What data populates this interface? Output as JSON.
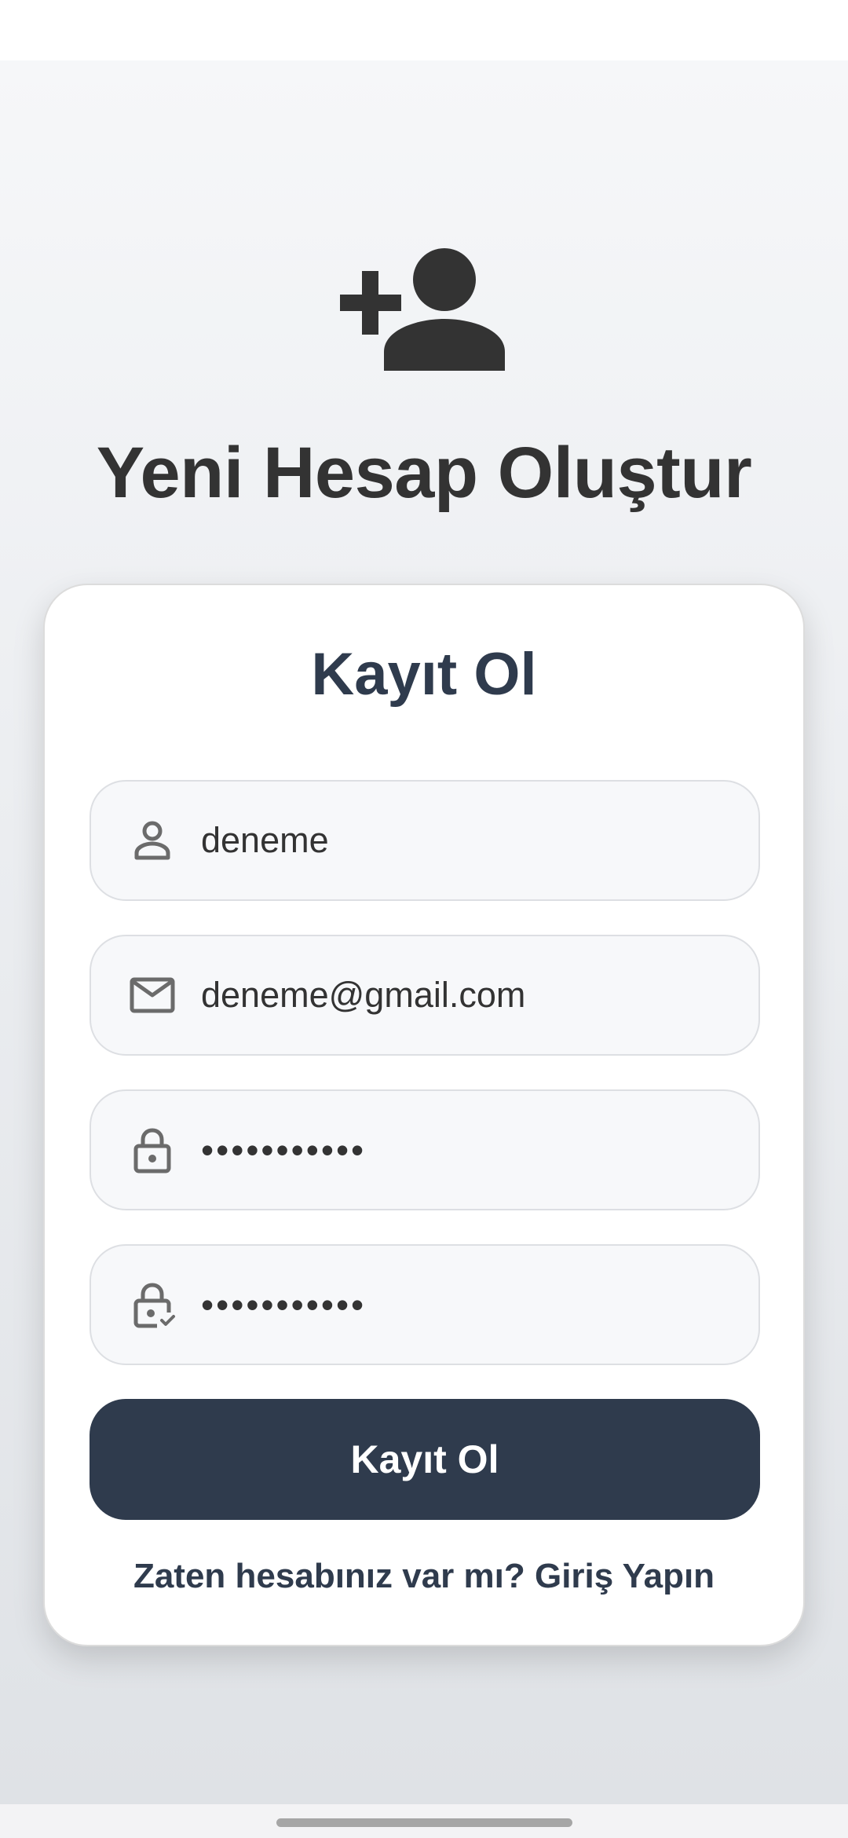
{
  "page": {
    "title": "Yeni Hesap Oluştur",
    "hero_icon": "person-add-icon"
  },
  "card": {
    "title": "Kayıt Ol",
    "fields": [
      {
        "name": "username",
        "icon": "person-icon",
        "value": "deneme"
      },
      {
        "name": "email",
        "icon": "mail-icon",
        "value": "deneme@gmail.com"
      },
      {
        "name": "password",
        "icon": "lock-icon",
        "value": "•••••••••••"
      },
      {
        "name": "password-confirm",
        "icon": "lock-check-icon",
        "value": "•••••••••••"
      }
    ],
    "submit_label": "Kayıt Ol",
    "login_link": "Zaten hesabınız var mı? Giriş Yapın"
  },
  "colors": {
    "primary": "#2f3b4d",
    "text": "#333333",
    "field_bg": "#f7f8fa",
    "icon": "#6b6b6b"
  }
}
